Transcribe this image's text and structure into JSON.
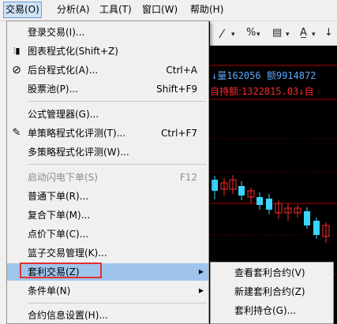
{
  "menubar": [
    {
      "label": "交易(O)",
      "open": true
    },
    {
      "label": "分析(A)"
    },
    {
      "label": "工具(T)"
    },
    {
      "label": "窗口(W)"
    },
    {
      "label": "帮助(H)"
    }
  ],
  "chart_info": {
    "arrow": "↓",
    "volume_label": "量",
    "volume_value": "162056",
    "amount_label": "额",
    "amount_value": "9914872",
    "position_label": "自持额:",
    "position_value": "1322815.03",
    "position_arrow": "↓",
    "position_suffix": "自"
  },
  "menu": {
    "items": [
      {
        "label": "登录交易(I)...",
        "shortcut": "",
        "icon": "",
        "disabled": false,
        "submenu": false
      },
      {
        "label": "图表程式化(Shift+Z)",
        "shortcut": "",
        "icon": "chart-program-icon",
        "disabled": false,
        "submenu": false
      },
      {
        "label": "后台程式化(A)...",
        "shortcut": "Ctrl+A",
        "icon": "background-program-icon",
        "disabled": false,
        "submenu": false
      },
      {
        "label": "股票池(P)...",
        "shortcut": "Shift+F9",
        "icon": "",
        "disabled": false,
        "submenu": false
      },
      {
        "label": "公式管理器(G)...",
        "shortcut": "",
        "icon": "",
        "disabled": false,
        "submenu": false
      },
      {
        "label": "单策略程式化评测(T)...",
        "shortcut": "Ctrl+F7",
        "icon": "edit-icon",
        "disabled": false,
        "submenu": false
      },
      {
        "label": "多策略程式化评测(W)...",
        "shortcut": "",
        "icon": "",
        "disabled": false,
        "submenu": false
      },
      {
        "label": "启动闪电下单(S)",
        "shortcut": "F12",
        "icon": "",
        "disabled": true,
        "submenu": false
      },
      {
        "label": "普通下单(R)...",
        "shortcut": "",
        "icon": "",
        "disabled": false,
        "submenu": false
      },
      {
        "label": "复合下单(M)...",
        "shortcut": "",
        "icon": "",
        "disabled": false,
        "submenu": false
      },
      {
        "label": "点价下单(C)...",
        "shortcut": "",
        "icon": "",
        "disabled": false,
        "submenu": false
      },
      {
        "label": "篮子交易管理(K)...",
        "shortcut": "",
        "icon": "",
        "disabled": false,
        "submenu": false
      },
      {
        "label": "套利交易(Z)",
        "shortcut": "",
        "icon": "",
        "disabled": false,
        "submenu": true,
        "highlighted": true
      },
      {
        "label": "条件单(N)",
        "shortcut": "",
        "icon": "",
        "disabled": false,
        "submenu": true
      },
      {
        "label": "合约信息设置(H)...",
        "shortcut": "",
        "icon": "",
        "disabled": false,
        "submenu": false
      }
    ]
  },
  "submenu": {
    "items": [
      {
        "label": "查看套利合约(V)"
      },
      {
        "label": "新建套利合约(Z)"
      },
      {
        "label": "套利持仓(G)..."
      }
    ]
  },
  "toolbar": {
    "draw_line_icon": "line-draw-icon",
    "percent_label": "%",
    "grid_icon": "grid-icon",
    "text_icon": "font-color-icon"
  },
  "colors": {
    "menu_bg": "#f0f0f0",
    "highlight": "#9fc5ec",
    "red_box": "#e03030",
    "chart_bg": "#000000",
    "candle_up": "#ff2a2a",
    "candle_down": "#3ad6ff"
  }
}
